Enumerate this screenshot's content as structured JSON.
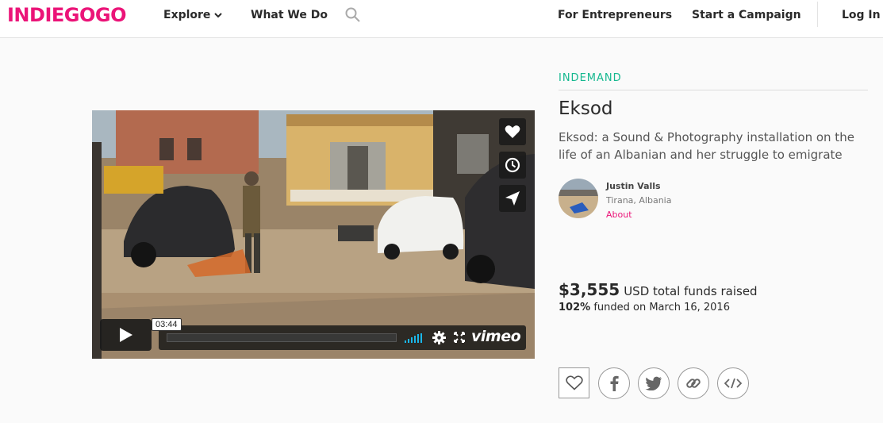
{
  "header": {
    "logo": "INDIEGOGO",
    "nav": {
      "explore": "Explore",
      "what_we_do": "What We Do",
      "for_entrepreneurs": "For Entrepreneurs",
      "start_campaign": "Start a Campaign",
      "login": "Log In"
    },
    "icons": [
      "chevron-down-icon",
      "search-icon"
    ]
  },
  "video": {
    "time": "03:44",
    "brand": "vimeo",
    "side_buttons": [
      "heart-icon",
      "clock-icon",
      "paper-plane-icon"
    ],
    "controls": [
      "play-icon",
      "volume-icon",
      "gear-icon",
      "fullscreen-icon"
    ]
  },
  "campaign": {
    "category": "INDEMAND",
    "title": "Eksod",
    "tagline": "Eksod: a Sound & Photography installation on the life of an Albanian and her struggle to emigrate",
    "owner": {
      "name": "Justin Valls",
      "location": "Tirana, Albania",
      "about_link": "About"
    },
    "funds": {
      "amount": "$3,555",
      "label": "USD total funds raised",
      "percent": "102%",
      "funded_text": "funded on March 16, 2016"
    },
    "share_icons": [
      "heart-outline-icon",
      "facebook-icon",
      "twitter-icon",
      "link-icon",
      "embed-icon"
    ]
  },
  "colors": {
    "brand_pink": "#eb1478",
    "category_green": "#15b88f",
    "vimeo_blue": "#1ab7ea"
  }
}
